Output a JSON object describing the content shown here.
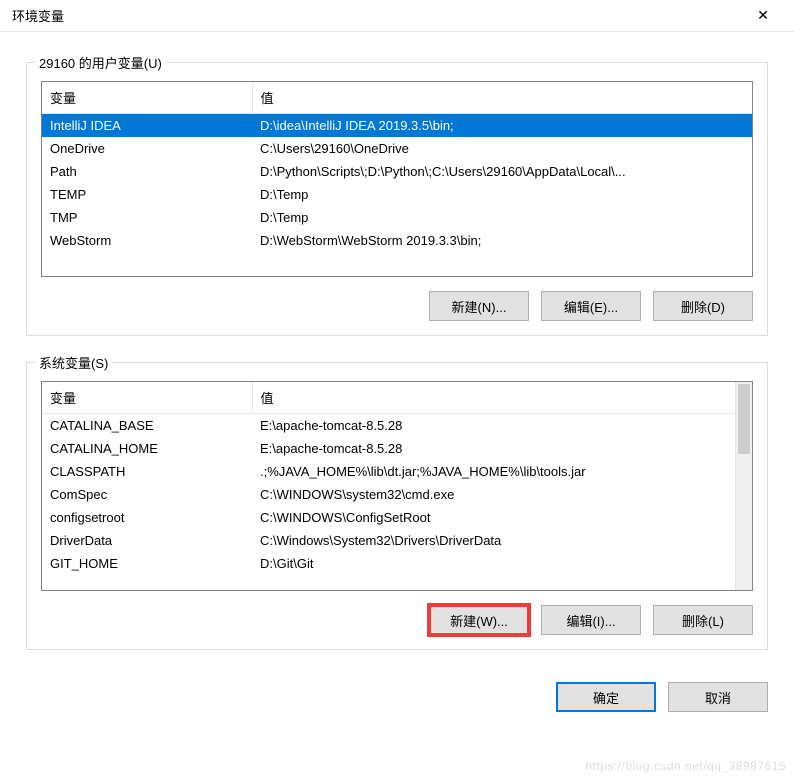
{
  "title": "环境变量",
  "userSection": {
    "label": "29160 的用户变量(U)",
    "headers": {
      "variable": "变量",
      "value": "值"
    },
    "rows": [
      {
        "variable": "IntelliJ IDEA",
        "value": "D:\\idea\\IntelliJ IDEA 2019.3.5\\bin;",
        "selected": true
      },
      {
        "variable": "OneDrive",
        "value": "C:\\Users\\29160\\OneDrive"
      },
      {
        "variable": "Path",
        "value": "D:\\Python\\Scripts\\;D:\\Python\\;C:\\Users\\29160\\AppData\\Local\\..."
      },
      {
        "variable": "TEMP",
        "value": "D:\\Temp"
      },
      {
        "variable": "TMP",
        "value": "D:\\Temp"
      },
      {
        "variable": "WebStorm",
        "value": "D:\\WebStorm\\WebStorm 2019.3.3\\bin;"
      }
    ],
    "buttons": {
      "new": "新建(N)...",
      "edit": "编辑(E)...",
      "delete": "删除(D)"
    }
  },
  "systemSection": {
    "label": "系统变量(S)",
    "headers": {
      "variable": "变量",
      "value": "值"
    },
    "rows": [
      {
        "variable": "CATALINA_BASE",
        "value": "E:\\apache-tomcat-8.5.28"
      },
      {
        "variable": "CATALINA_HOME",
        "value": "E:\\apache-tomcat-8.5.28"
      },
      {
        "variable": "CLASSPATH",
        "value": ".;%JAVA_HOME%\\lib\\dt.jar;%JAVA_HOME%\\lib\\tools.jar"
      },
      {
        "variable": "ComSpec",
        "value": "C:\\WINDOWS\\system32\\cmd.exe"
      },
      {
        "variable": "configsetroot",
        "value": "C:\\WINDOWS\\ConfigSetRoot"
      },
      {
        "variable": "DriverData",
        "value": "C:\\Windows\\System32\\Drivers\\DriverData"
      },
      {
        "variable": "GIT_HOME",
        "value": "D:\\Git\\Git"
      }
    ],
    "buttons": {
      "new": "新建(W)...",
      "edit": "编辑(I)...",
      "delete": "删除(L)"
    }
  },
  "dialogButtons": {
    "ok": "确定",
    "cancel": "取消"
  },
  "watermark": "https://blog.csdn.net/qq_38987615"
}
